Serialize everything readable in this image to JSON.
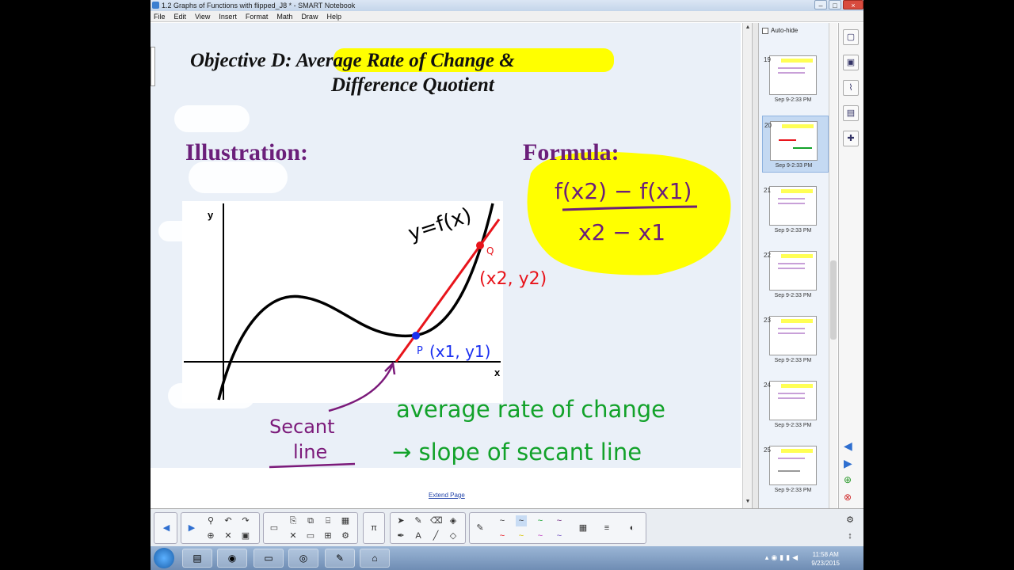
{
  "window": {
    "title": "1.2 Graphs of Functions with flipped_J8 * - SMART Notebook",
    "buttons": {
      "minimize": "–",
      "maximize": "□",
      "close": "×"
    }
  },
  "menu": [
    "File",
    "Edit",
    "View",
    "Insert",
    "Format",
    "Math",
    "Draw",
    "Help"
  ],
  "slide": {
    "title_prefix": "Objective D: ",
    "title_highlight": "Average Rate of Change",
    "title_suffix": " &",
    "title_line2": "Difference Quotient",
    "illustration_label": "Illustration:",
    "formula_label": "Formula:",
    "graph": {
      "y_axis": "y",
      "x_axis": "x",
      "curve_label": "y=f(x)",
      "point_q": "Q",
      "point_q_coords": "(x2, y2)",
      "point_p": "P",
      "point_p_coords": "(x1, y1)"
    },
    "formula": {
      "numerator": "f(x2) − f(x1)",
      "denominator": "x2 − x1"
    },
    "secant_label_1": "Secant",
    "secant_label_2": "line",
    "note_line1": "average rate of change",
    "note_line2": "→ slope of secant line",
    "colors": {
      "title_purple": "#6b1f7a",
      "highlight": "#ffff00",
      "red": "#e8141b",
      "green": "#12a22a",
      "blue": "#1a2ff0"
    }
  },
  "extend_page": "Extend Page",
  "sidebar": {
    "autohide": "Auto-hide",
    "thumbnails": [
      {
        "num": "19",
        "date": "Sep 9-2:33 PM",
        "selected": false
      },
      {
        "num": "20",
        "date": "Sep 9-2:33 PM",
        "selected": true
      },
      {
        "num": "21",
        "date": "Sep 9-2:33 PM",
        "selected": false
      },
      {
        "num": "22",
        "date": "Sep 9-2:33 PM",
        "selected": false
      },
      {
        "num": "23",
        "date": "Sep 9-2:33 PM",
        "selected": false
      },
      {
        "num": "24",
        "date": "Sep 9-2:33 PM",
        "selected": false
      },
      {
        "num": "25",
        "date": "Sep 9-2:33 PM",
        "selected": false
      }
    ]
  },
  "taskbar": {
    "time": "11:58 AM",
    "date": "9/23/2015"
  }
}
